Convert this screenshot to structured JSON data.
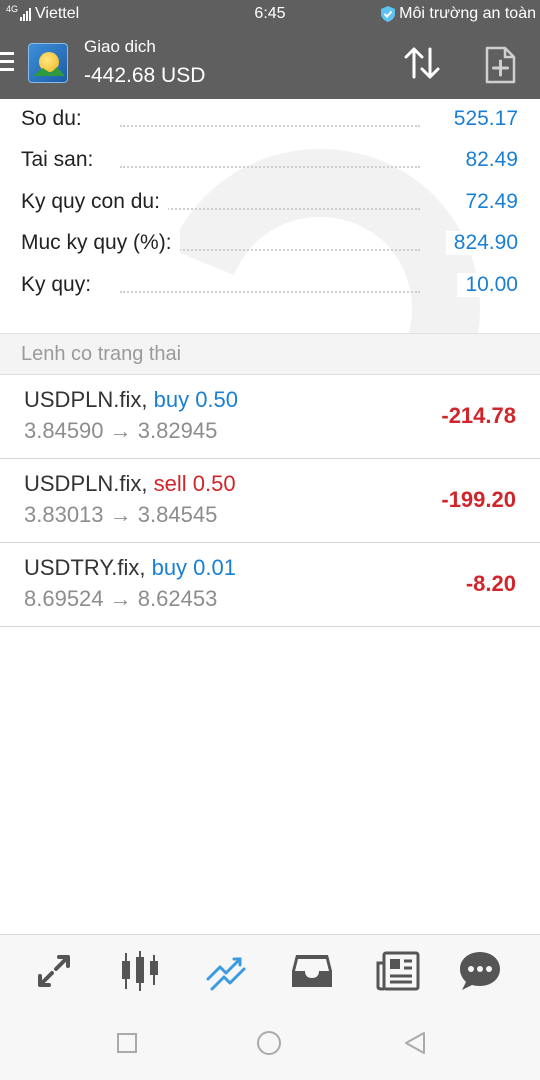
{
  "status_bar": {
    "network_tag": "4G",
    "carrier": "Viettel",
    "time": "6:45",
    "security_text": "Môi trường an toàn"
  },
  "header": {
    "title": "Giao dich",
    "subtitle": "-442.68 USD"
  },
  "account": [
    {
      "label": "So du:",
      "value": "525.17"
    },
    {
      "label": "Tai san:",
      "value": "82.49"
    },
    {
      "label": "Ky quy con du:",
      "value": "72.49"
    },
    {
      "label": "Muc ky quy (%):",
      "value": "824.90"
    },
    {
      "label": "Ky quy:",
      "value": "10.00"
    }
  ],
  "section_title": "Lenh co trang thai",
  "positions": [
    {
      "symbol": "USDPLN.fix,",
      "action": "buy 0.50",
      "side": "buy",
      "open_price": "3.84590",
      "arrow": "→",
      "current_price": "3.82945",
      "profit": "-214.78"
    },
    {
      "symbol": "USDPLN.fix,",
      "action": "sell 0.50",
      "side": "sell",
      "open_price": "3.83013",
      "arrow": "→",
      "current_price": "3.84545",
      "profit": "-199.20"
    },
    {
      "symbol": "USDTRY.fix,",
      "action": "buy 0.01",
      "side": "buy",
      "open_price": "8.69524",
      "arrow": "→",
      "current_price": "8.62453",
      "profit": "-8.20"
    }
  ],
  "bottom_nav": [
    {
      "icon": "quotes-arrows-icon",
      "active": false
    },
    {
      "icon": "candlestick-chart-icon",
      "active": false
    },
    {
      "icon": "trade-trend-icon",
      "active": true
    },
    {
      "icon": "inbox-icon",
      "active": false
    },
    {
      "icon": "news-icon",
      "active": false
    },
    {
      "icon": "chat-icon",
      "active": false
    }
  ],
  "colors": {
    "header_bg": "#5f5f5f",
    "value_blue": "#1a7fd3",
    "loss_red": "#d0262b",
    "muted_gray": "#8d8d8d"
  }
}
